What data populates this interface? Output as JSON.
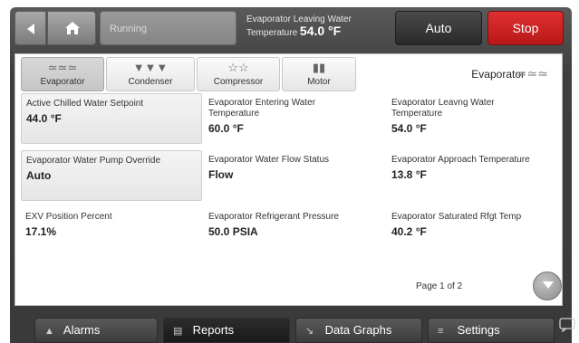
{
  "header": {
    "status": "Running",
    "readout_label_line1": "Evaporator Leaving Water",
    "readout_label_line2": "Temperature",
    "readout_value": "54.0 °F",
    "auto_label": "Auto",
    "stop_label": "Stop"
  },
  "tabs": [
    {
      "label": "Evaporator",
      "icon": "evaporator-icon",
      "glyph": "≃≃≃",
      "active": true
    },
    {
      "label": "Condenser",
      "icon": "condenser-icon",
      "glyph": "▼▼▼"
    },
    {
      "label": "Compressor",
      "icon": "compressor-icon",
      "glyph": "☆☆"
    },
    {
      "label": "Motor",
      "icon": "motor-icon",
      "glyph": "▮▮"
    }
  ],
  "section": {
    "title": "Evaporator",
    "icon": "evaporator-heat-icon",
    "glyph": "≃≃≃"
  },
  "values": [
    {
      "label": "Active Chilled Water Setpoint",
      "value": "44.0 °F",
      "boxed": true
    },
    {
      "label": "Evaporator Entering Water Temperature",
      "value": "60.0 °F",
      "boxed": false
    },
    {
      "label": "Evaporator Leavng Water Temperature",
      "value": "54.0 °F",
      "boxed": false
    },
    {
      "label": "Evaporator Water Pump Override",
      "value": "Auto",
      "boxed": true
    },
    {
      "label": "Evaporator Water Flow Status",
      "value": "Flow",
      "boxed": false
    },
    {
      "label": "Evaporator Approach Temperature",
      "value": "13.8 °F",
      "boxed": false
    },
    {
      "label": "EXV Position Percent",
      "value": "17.1%",
      "boxed": false
    },
    {
      "label": "Evaporator Refrigerant Pressure",
      "value": "50.0 PSIA",
      "boxed": false
    },
    {
      "label": "Evaporator Saturated Rfgt Temp",
      "value": "40.2 °F",
      "boxed": false
    }
  ],
  "pagination": {
    "text": "Page 1 of 2"
  },
  "nav": [
    {
      "label": "Alarms",
      "icon": "alarm-bell-icon",
      "glyph": "▲"
    },
    {
      "label": "Reports",
      "icon": "report-document-icon",
      "glyph": "▤",
      "active": true
    },
    {
      "label": "Data Graphs",
      "icon": "graph-icon",
      "glyph": "↘"
    },
    {
      "label": "Settings",
      "icon": "settings-sliders-icon",
      "glyph": "≡"
    }
  ],
  "colors": {
    "stop": "#c81e1e",
    "auto": "#2a2a2a",
    "device": "#3e3e3e"
  }
}
